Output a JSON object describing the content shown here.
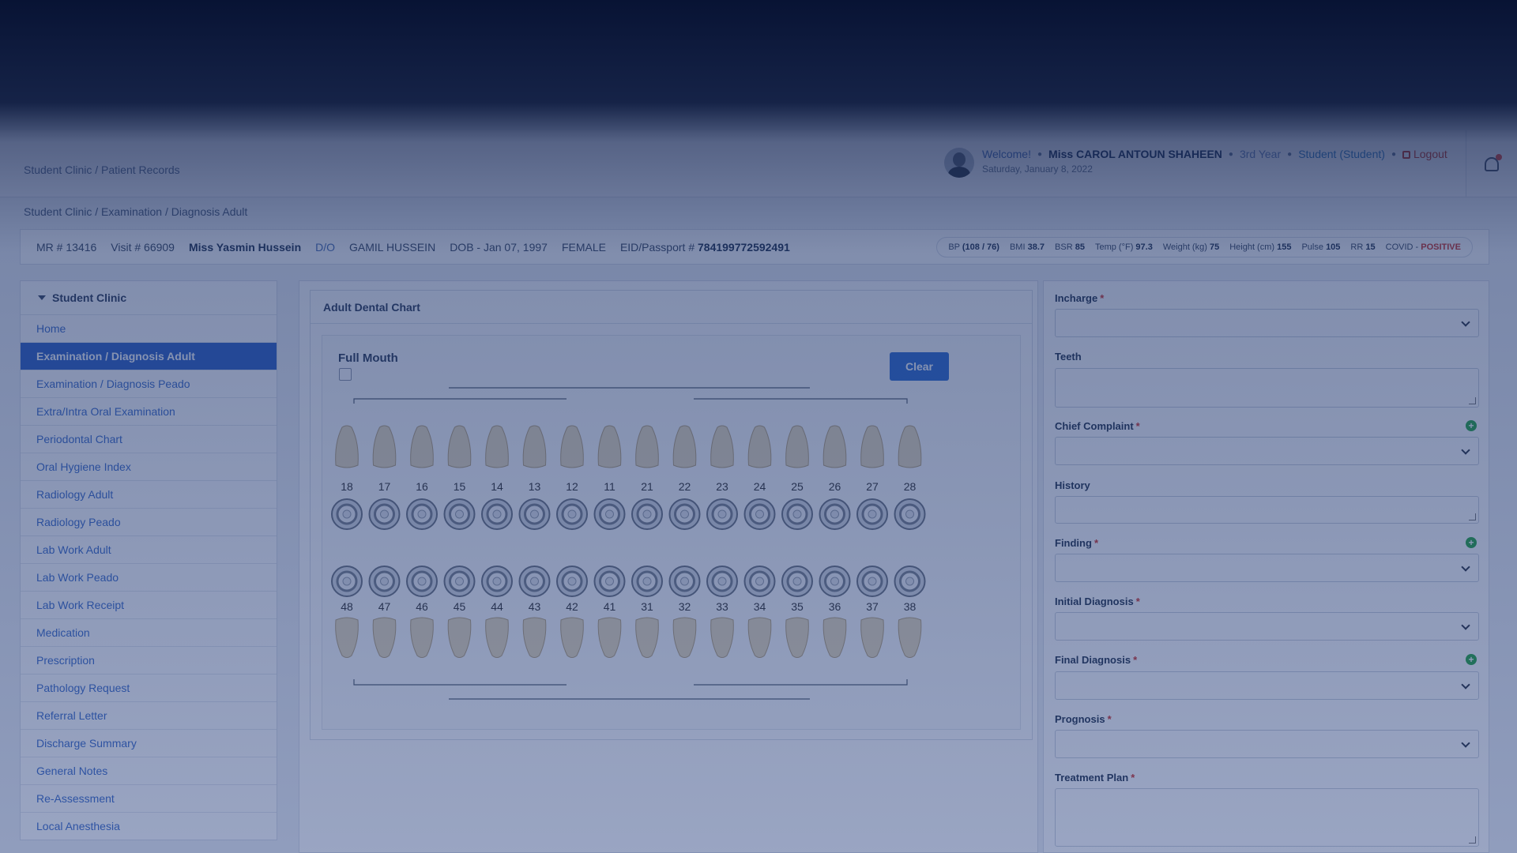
{
  "header": {
    "welcome": "Welcome!",
    "user_name": "Miss CAROL ANTOUN SHAHEEN",
    "year": "3rd Year",
    "role": "Student (Student)",
    "logout": "Logout",
    "date": "Saturday, January 8, 2022"
  },
  "breadcrumb": {
    "title": "Student Clinic / Patient Records",
    "path": "Student Clinic / Examination / Diagnosis Adult"
  },
  "patient": {
    "mrn": "MR # 13416",
    "visit": "Visit # 66909",
    "name": "Miss Yasmin Hussein",
    "relation": "D/O",
    "guardian": "GAMIL HUSSEIN",
    "dob": "DOB - Jan 07, 1997",
    "gender": "FEMALE",
    "eid_label": "EID/Passport #",
    "eid": "784199772592491"
  },
  "vitals": {
    "bp_label": "BP",
    "bp": "(108 / 76)",
    "bmi_label": "BMI",
    "bmi": "38.7",
    "bsr_label": "BSR",
    "bsr": "85",
    "temp_label": "Temp (°F)",
    "temp": "97.3",
    "weight_label": "Weight (kg)",
    "weight": "75",
    "height_label": "Height (cm)",
    "height": "155",
    "pulse_label": "Pulse",
    "pulse": "105",
    "rr_label": "RR",
    "rr": "15",
    "covid_label": "COVID -",
    "covid": "POSITIVE"
  },
  "sidebar": {
    "title": "Student Clinic",
    "items": [
      {
        "label": "Home"
      },
      {
        "label": "Examination / Diagnosis Adult"
      },
      {
        "label": "Examination / Diagnosis Peado"
      },
      {
        "label": "Extra/Intra Oral Examination"
      },
      {
        "label": "Periodontal Chart"
      },
      {
        "label": "Oral Hygiene Index"
      },
      {
        "label": "Radiology Adult"
      },
      {
        "label": "Radiology Peado"
      },
      {
        "label": "Lab Work Adult"
      },
      {
        "label": "Lab Work Peado"
      },
      {
        "label": "Lab Work Receipt"
      },
      {
        "label": "Medication"
      },
      {
        "label": "Prescription"
      },
      {
        "label": "Pathology Request"
      },
      {
        "label": "Referral Letter"
      },
      {
        "label": "Discharge Summary"
      },
      {
        "label": "General Notes"
      },
      {
        "label": "Re-Assessment"
      },
      {
        "label": "Local Anesthesia"
      }
    ]
  },
  "chart": {
    "title": "Adult Dental Chart",
    "full_mouth_label": "Full Mouth",
    "clear_label": "Clear",
    "upper_teeth": [
      "18",
      "17",
      "16",
      "15",
      "14",
      "13",
      "12",
      "11",
      "21",
      "22",
      "23",
      "24",
      "25",
      "26",
      "27",
      "28"
    ],
    "lower_teeth": [
      "48",
      "47",
      "46",
      "45",
      "44",
      "43",
      "42",
      "41",
      "31",
      "32",
      "33",
      "34",
      "35",
      "36",
      "37",
      "38"
    ]
  },
  "form": {
    "incharge_label": "Incharge",
    "teeth_label": "Teeth",
    "chief_complaint_label": "Chief Complaint",
    "history_label": "History",
    "finding_label": "Finding",
    "initial_diagnosis_label": "Initial Diagnosis",
    "final_diagnosis_label": "Final Diagnosis",
    "prognosis_label": "Prognosis",
    "treatment_plan_label": "Treatment Plan"
  },
  "colors": {
    "overlay": "#0a1840",
    "accent": "#2f6dd2",
    "danger": "#d0342c",
    "add": "#28a745"
  }
}
